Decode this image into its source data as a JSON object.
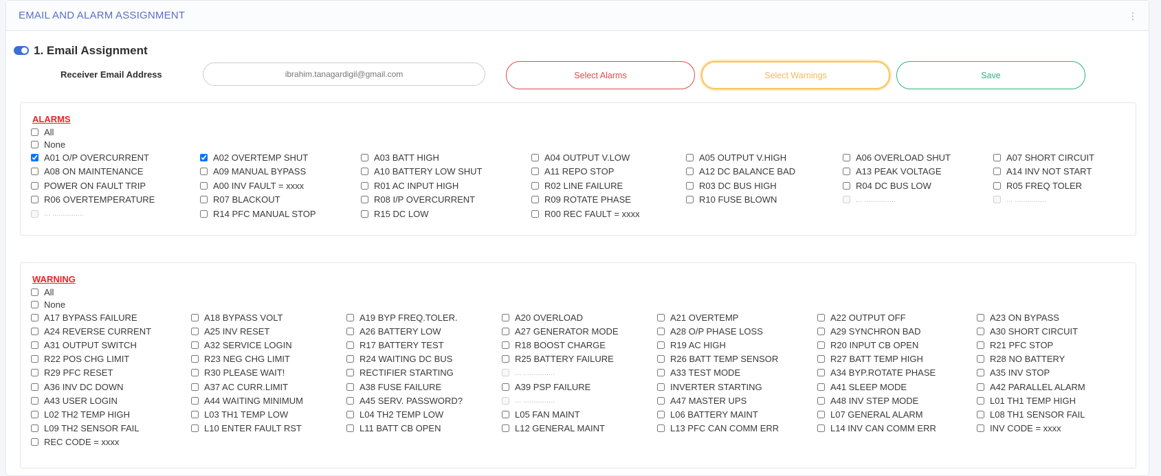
{
  "header": {
    "title": "EMAIL AND ALARM ASSIGNMENT"
  },
  "email_section": {
    "title": "1. Email Assignment",
    "toggle_on": true,
    "receiver_label": "Receiver Email Address",
    "receiver_value": "ibrahim.tanagardigil@gmail.com",
    "buttons": {
      "alarms": "Select Alarms",
      "warnings": "Select Warnings",
      "save": "Save"
    }
  },
  "alarms": {
    "title": "ALARMS",
    "all_label": "All",
    "none_label": "None",
    "rows": [
      [
        [
          "A01 O/P OVERCURRENT",
          true
        ],
        [
          "A02 OVERTEMP SHUT",
          true
        ],
        [
          "A03 BATT HIGH",
          false
        ],
        [
          "A04 OUTPUT V.LOW",
          false
        ],
        [
          "A05 OUTPUT V.HIGH",
          false
        ],
        [
          "A06 OVERLOAD SHUT",
          false
        ],
        [
          "A07 SHORT CIRCUIT",
          false
        ]
      ],
      [
        [
          "A08 ON MAINTENANCE",
          false
        ],
        [
          "A09 MANUAL BYPASS",
          false
        ],
        [
          "A10 BATTERY LOW SHUT",
          false
        ],
        [
          "A11 REPO STOP",
          false
        ],
        [
          "A12 DC BALANCE BAD",
          false
        ],
        [
          "A13 PEAK VOLTAGE",
          false
        ],
        [
          "A14 INV NOT START",
          false
        ]
      ],
      [
        [
          "POWER ON FAULT TRIP",
          false
        ],
        [
          "A00 INV FAULT = xxxx",
          false
        ],
        [
          "R01 AC INPUT HIGH",
          false
        ],
        [
          "R02 LINE FAILURE",
          false
        ],
        [
          "R03 DC BUS HIGH",
          false
        ],
        [
          "R04 DC BUS LOW",
          false
        ],
        [
          "R05 FREQ TOLER",
          false
        ]
      ],
      [
        [
          "R06 OVERTEMPERATURE",
          false
        ],
        [
          "R07 BLACKOUT",
          false
        ],
        [
          "R08 I/P OVERCURRENT",
          false
        ],
        [
          "R09 ROTATE PHASE",
          false
        ],
        [
          "R10 FUSE BLOWN",
          false
        ],
        [
          "... ...............",
          null
        ],
        [
          "... ...............",
          null
        ]
      ],
      [
        [
          "... ...............",
          null
        ],
        [
          "R14 PFC MANUAL STOP",
          false
        ],
        [
          "R15 DC LOW",
          false
        ],
        [
          "R00 REC FAULT = xxxx",
          false
        ]
      ]
    ]
  },
  "warnings": {
    "title": "WARNING",
    "all_label": "All",
    "none_label": "None",
    "rows": [
      [
        [
          "A17 BYPASS FAILURE",
          false
        ],
        [
          "A18 BYPASS VOLT",
          false
        ],
        [
          "A19 BYP FREQ.TOLER.",
          false
        ],
        [
          "A20 OVERLOAD",
          false
        ],
        [
          "A21 OVERTEMP",
          false
        ],
        [
          "A22 OUTPUT OFF",
          false
        ],
        [
          "A23 ON BYPASS",
          false
        ]
      ],
      [
        [
          "A24 REVERSE CURRENT",
          false
        ],
        [
          "A25 INV RESET",
          false
        ],
        [
          "A26 BATTERY LOW",
          false
        ],
        [
          "A27 GENERATOR MODE",
          false
        ],
        [
          "A28 O/P PHASE LOSS",
          false
        ],
        [
          "A29 SYNCHRON BAD",
          false
        ],
        [
          "A30 SHORT CIRCUIT",
          false
        ]
      ],
      [
        [
          "A31 OUTPUT SWITCH",
          false
        ],
        [
          "A32 SERVICE LOGIN",
          false
        ],
        [
          "R17 BATTERY TEST",
          false
        ],
        [
          "R18 BOOST CHARGE",
          false
        ],
        [
          "R19 AC HIGH",
          false
        ],
        [
          "R20 INPUT CB OPEN",
          false
        ],
        [
          "R21 PFC STOP",
          false
        ]
      ],
      [
        [
          "R22 POS CHG LIMIT",
          false
        ],
        [
          "R23 NEG CHG LIMIT",
          false
        ],
        [
          "R24 WAITING DC BUS",
          false
        ],
        [
          "R25 BATTERY FAILURE",
          false
        ],
        [
          "R26 BATT TEMP SENSOR",
          false
        ],
        [
          "R27 BATT TEMP HIGH",
          false
        ],
        [
          "R28 NO BATTERY",
          false
        ]
      ],
      [
        [
          "R29 PFC RESET",
          false
        ],
        [
          "R30 PLEASE WAIT!",
          false
        ],
        [
          "RECTIFIER STARTING",
          false
        ],
        [
          "... ...............",
          null
        ],
        [
          "A33 TEST MODE",
          false
        ],
        [
          "A34 BYP.ROTATE PHASE",
          false
        ],
        [
          "A35 INV STOP",
          false
        ]
      ],
      [
        [
          "A36 INV DC DOWN",
          false
        ],
        [
          "A37 AC CURR.LIMIT",
          false
        ],
        [
          "A38 FUSE FAILURE",
          false
        ],
        [
          "A39 PSP FAILURE",
          false
        ],
        [
          "INVERTER STARTING",
          false
        ],
        [
          "A41 SLEEP MODE",
          false
        ],
        [
          "A42 PARALLEL ALARM",
          false
        ]
      ],
      [
        [
          "A43 USER LOGIN",
          false
        ],
        [
          "A44 WAITING MINIMUM",
          false
        ],
        [
          "A45 SERV. PASSWORD?",
          false
        ],
        [
          "... ...............",
          null
        ],
        [
          "A47 MASTER UPS",
          false
        ],
        [
          "A48 INV STEP MODE",
          false
        ],
        [
          "L01 TH1 TEMP HIGH",
          false
        ]
      ],
      [
        [
          "L02 TH2 TEMP HIGH",
          false
        ],
        [
          "L03 TH1 TEMP LOW",
          false
        ],
        [
          "L04 TH2 TEMP LOW",
          false
        ],
        [
          "L05 FAN MAINT",
          false
        ],
        [
          "L06 BATTERY MAINT",
          false
        ],
        [
          "L07 GENERAL ALARM",
          false
        ],
        [
          "L08 TH1 SENSOR FAIL",
          false
        ]
      ],
      [
        [
          "L09 TH2 SENSOR FAIL",
          false
        ],
        [
          "L10 ENTER FAULT RST",
          false
        ],
        [
          "L11 BATT CB OPEN",
          false
        ],
        [
          "L12 GENERAL MAINT",
          false
        ],
        [
          "L13 PFC CAN COMM ERR",
          false
        ],
        [
          "L14 INV CAN COMM ERR",
          false
        ],
        [
          "INV CODE = xxxx",
          false
        ]
      ],
      [
        [
          "REC CODE = xxxx",
          false
        ]
      ]
    ]
  }
}
